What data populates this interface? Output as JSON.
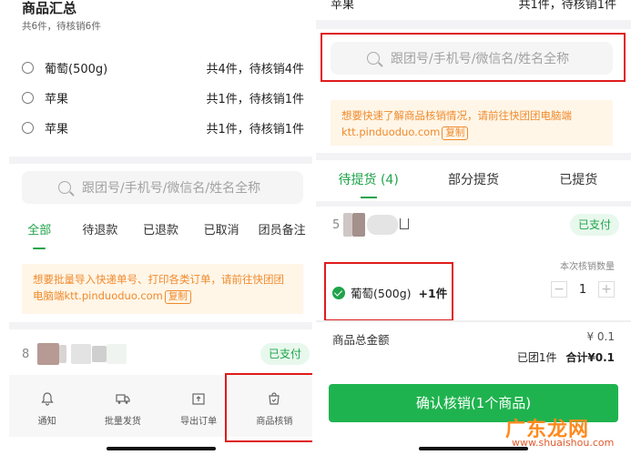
{
  "left": {
    "summary": {
      "title": "商品汇总",
      "subtitle": "共6件，待核销6件",
      "items": [
        {
          "name": "葡萄(500g)",
          "qty": "共4件，待核销4件"
        },
        {
          "name": "苹果",
          "qty": "共1件，待核销1件"
        },
        {
          "name": "苹果",
          "qty": "共1件，待核销1件"
        }
      ]
    },
    "search_placeholder": "跟团号/手机号/微信名/姓名全称",
    "tabs": [
      {
        "label": "全部"
      },
      {
        "label": "待退款"
      },
      {
        "label": "已退款"
      },
      {
        "label": "已取消"
      },
      {
        "label": "团员备注"
      }
    ],
    "notice": {
      "text": "想要批量导入快递单号、打印各类订单，请前往快团团电脑端ktt.pinduoduo.com",
      "copy_label": "复制"
    },
    "order": {
      "number": "8",
      "status": "已支付"
    },
    "bottom_nav": [
      {
        "label": "通知",
        "icon": "bell-icon"
      },
      {
        "label": "批量发货",
        "icon": "truck-icon"
      },
      {
        "label": "导出订单",
        "icon": "export-icon"
      },
      {
        "label": "商品核销",
        "icon": "bag-check-icon"
      }
    ]
  },
  "right": {
    "top_item": {
      "name": "苹果",
      "qty": "共1件，待核销1件"
    },
    "search_placeholder": "跟团号/手机号/微信名/姓名全称",
    "notice": {
      "line1": "想要快速了解商品核销情况，请前往快团团电脑端",
      "line2": "ktt.pinduoduo.com",
      "copy_label": "复制"
    },
    "tabs": [
      {
        "label": "待提货 (4)"
      },
      {
        "label": "部分提货"
      },
      {
        "label": "已提货"
      }
    ],
    "order": {
      "number": "5",
      "status": "已支付",
      "quantity_label": "本次核销数量",
      "product": "葡萄(500g)",
      "product_count": "+1件",
      "stepper_value": "1",
      "total_label": "商品总金额",
      "total_value": "¥ 0.1",
      "summary_prefix": "已团1件",
      "summary_total": "合计¥0.1"
    },
    "confirm_label": "确认核销(1个商品)"
  },
  "watermark": {
    "text": "广东龙网",
    "url": "www.shuaishou.com"
  },
  "colors": {
    "accent": "#1fa34a",
    "highlight_box": "#e01b1b",
    "notice_text": "#f08a2b"
  }
}
